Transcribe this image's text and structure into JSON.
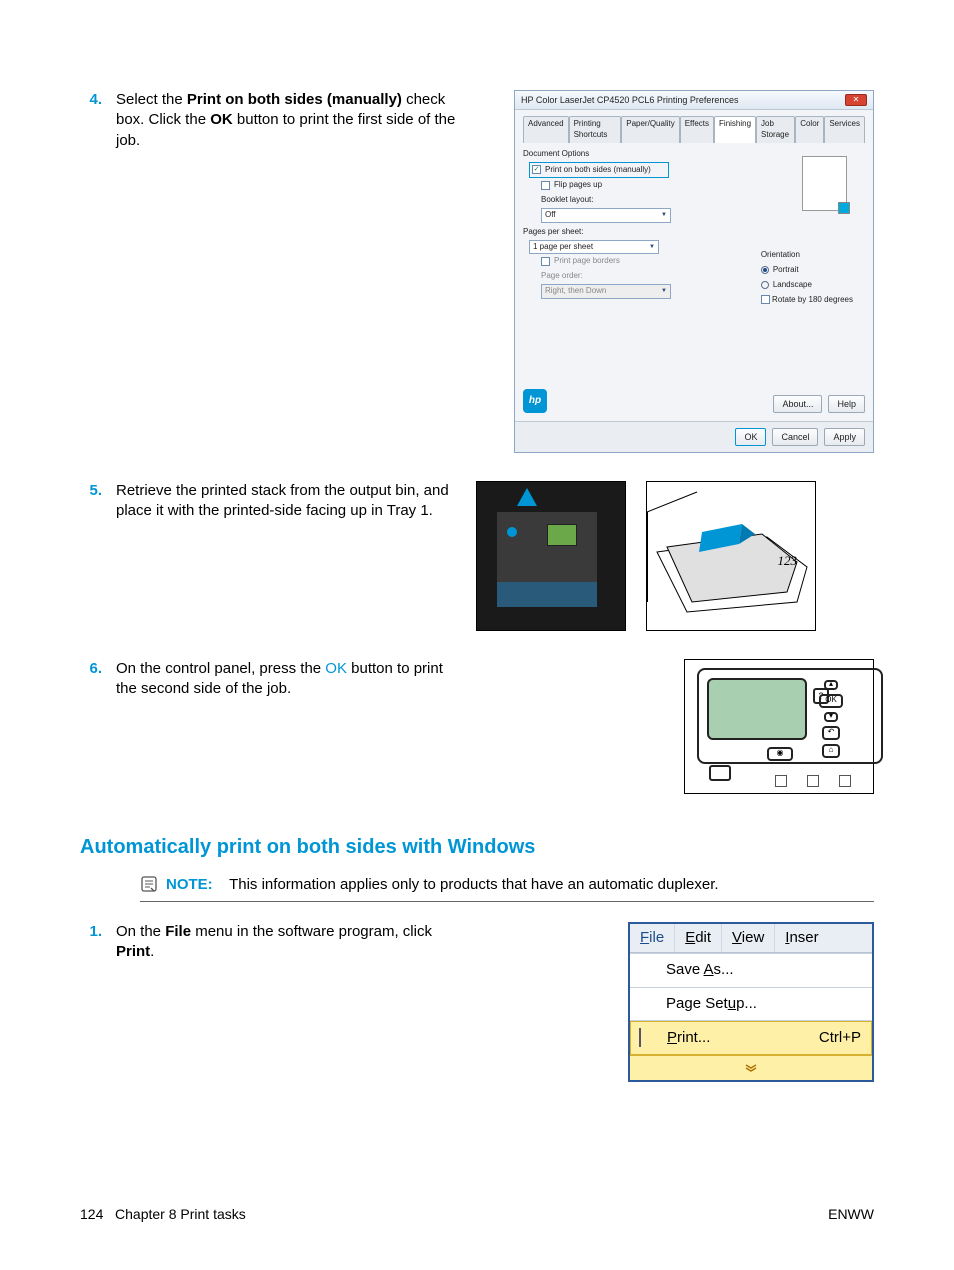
{
  "steps": {
    "s4": {
      "num": "4.",
      "text_pre": "Select the ",
      "bold1": "Print on both sides (manually)",
      "text_mid": " check box. Click the ",
      "bold2": "OK",
      "text_post": " button to print the first side of the job."
    },
    "s5": {
      "num": "5.",
      "text": "Retrieve the printed stack from the output bin, and place it with the printed-side facing up in Tray 1."
    },
    "s6": {
      "num": "6.",
      "text_pre": "On the control panel, press the ",
      "link": "OK",
      "text_post": " button to print the second side of the job."
    },
    "s1": {
      "num": "1.",
      "text_pre": "On the ",
      "bold1": "File",
      "text_mid": " menu in the software program, click ",
      "bold2": "Print",
      "text_post": "."
    }
  },
  "dialog": {
    "title": "HP Color LaserJet CP4520 PCL6 Printing Preferences",
    "close": "✕",
    "tabs": [
      "Advanced",
      "Printing Shortcuts",
      "Paper/Quality",
      "Effects",
      "Finishing",
      "Job Storage",
      "Color",
      "Services"
    ],
    "active_tab": 4,
    "doc_options_label": "Document Options",
    "print_both_sides": "Print on both sides (manually)",
    "flip_pages": "Flip pages up",
    "booklet_layout": "Booklet layout:",
    "booklet_value": "Off",
    "pages_per_sheet": "Pages per sheet:",
    "pages_value": "1 page per sheet",
    "print_borders": "Print page borders",
    "page_order": "Page order:",
    "page_order_value": "Right, then Down",
    "orientation_label": "Orientation",
    "portrait": "Portrait",
    "landscape": "Landscape",
    "rotate": "Rotate by 180 degrees",
    "about_btn": "About...",
    "help_btn": "Help",
    "ok_btn": "OK",
    "cancel_btn": "Cancel",
    "apply_btn": "Apply"
  },
  "tray_num": "123",
  "control_ok": "OK",
  "section_heading": "Automatically print on both sides with Windows",
  "note": {
    "label": "NOTE:",
    "text": "This information applies only to products that have an automatic duplexer."
  },
  "menu": {
    "items": {
      "file": "File",
      "edit": "Edit",
      "view": "View",
      "insert": "Inser"
    },
    "save_as": "Save As...",
    "page_setup": "Page Setup...",
    "print": "Print...",
    "print_kb": "Ctrl+P",
    "expand": "▾"
  },
  "footer": {
    "page_num": "124",
    "chapter": "Chapter 8   Print tasks",
    "enww": "ENWW"
  }
}
